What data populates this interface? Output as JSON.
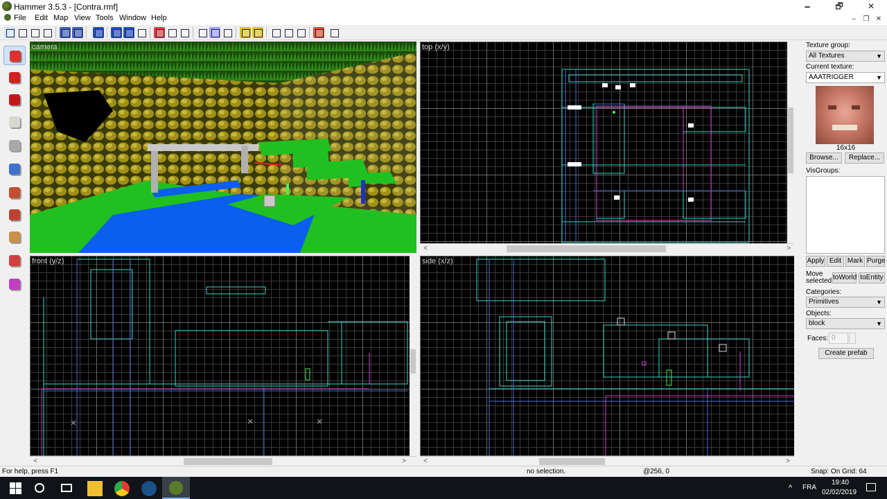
{
  "window": {
    "title": "Hammer 3.5.3 - [Contra.rmf]",
    "minimize": "🗕",
    "maximize": "🗗",
    "close": "✕",
    "mdi_min": "–",
    "mdi_max": "❐",
    "mdi_close": "✕"
  },
  "menu": [
    "File",
    "Edit",
    "Map",
    "View",
    "Tools",
    "Window",
    "Help"
  ],
  "viewports": {
    "camera": "camera",
    "top": "top (x/y)",
    "front": "front (y/z)",
    "side": "side (x/z)"
  },
  "scroll": {
    "left": "<",
    "right": ">",
    "up": "^",
    "down": "v"
  },
  "texture_panel": {
    "texture_group_label": "Texture group:",
    "texture_group_value": "All Textures",
    "current_texture_label": "Current texture:",
    "current_texture_value": "AAATRIGGER",
    "texture_size": "16x16",
    "browse": "Browse...",
    "replace": "Replace...",
    "visgroups_label": "VisGroups:",
    "apply": "Apply",
    "edit": "Edit",
    "mark": "Mark",
    "purge": "Purge",
    "move_selected": "Move selected:",
    "to_world": "toWorld",
    "to_entity": "toEntity",
    "categories_label": "Categories:",
    "categories_value": "Primitives",
    "objects_label": "Objects:",
    "objects_value": "block",
    "faces_label": "Faces:",
    "faces_value": "0",
    "create_prefab": "Create prefab"
  },
  "status": {
    "help": "For help, press F1",
    "selection": "no selection.",
    "coords": "@256, 0",
    "snap": "Snap: On Grid: 64"
  },
  "taskbar": {
    "lang": "FRA",
    "time": "19:40",
    "date": "02/02/2019"
  },
  "colors": {
    "grid_bg": "#000000",
    "cyan_brush": "#39d8c8",
    "blue_brush": "#4a6ed8",
    "magenta_brush": "#d040d0",
    "water": "#0a5ef0",
    "grass": "#22c020"
  }
}
